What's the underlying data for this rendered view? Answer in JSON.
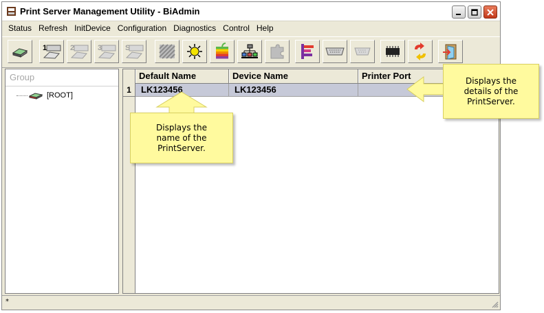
{
  "window": {
    "title": "Print Server Management Utility - BiAdmin"
  },
  "menu": [
    "Status",
    "Refresh",
    "InitDevice",
    "Configuration",
    "Diagnostics",
    "Control",
    "Help"
  ],
  "toolbar": {
    "buttons": [
      {
        "icon": "printer-device-icon",
        "enabled": true
      },
      {
        "icon": "port-1-icon",
        "enabled": true
      },
      {
        "icon": "port-2-icon",
        "enabled": false
      },
      {
        "icon": "port-3-icon",
        "enabled": false
      },
      {
        "icon": "port-s-icon",
        "enabled": false
      },
      {
        "icon": "hatched-icon",
        "enabled": false
      },
      {
        "icon": "sun-bug-icon",
        "enabled": true
      },
      {
        "icon": "apple-icon",
        "enabled": true
      },
      {
        "icon": "network-tree-icon",
        "enabled": true
      },
      {
        "icon": "puzzle-icon",
        "enabled": false
      },
      {
        "icon": "flag-icon",
        "enabled": true
      },
      {
        "icon": "parallel-port-icon",
        "enabled": true
      },
      {
        "icon": "serial-port-icon",
        "enabled": false
      },
      {
        "icon": "chip-icon",
        "enabled": true
      },
      {
        "icon": "refresh-arrows-icon",
        "enabled": true
      },
      {
        "icon": "exit-door-icon",
        "enabled": true
      }
    ]
  },
  "tree": {
    "header": "Group",
    "root_label": "[ROOT]"
  },
  "grid": {
    "columns": [
      "Default Name",
      "Device Name",
      "Printer Port"
    ],
    "rows": [
      {
        "num": "1",
        "default_name": "LK123456",
        "device_name": "LK123456",
        "printer_port": ""
      }
    ]
  },
  "status": {
    "text": "*"
  },
  "callouts": {
    "name": "Displays the name of the PrintServer.",
    "details": "Displays the details of the PrintServer."
  },
  "colors": {
    "callout_fill": "#fffa9e",
    "callout_border": "#d8cf60",
    "row_highlight": "#c6c9d8",
    "close_red": "#d9532e"
  }
}
